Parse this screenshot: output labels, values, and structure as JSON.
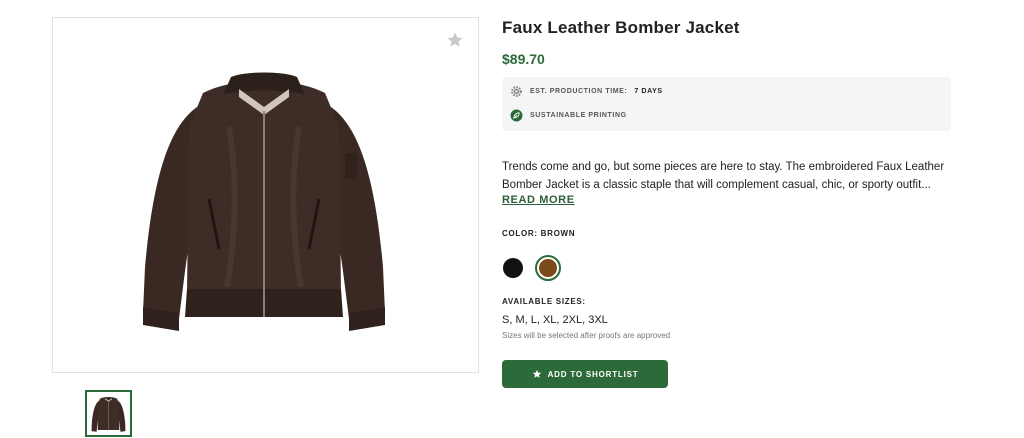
{
  "product": {
    "title": "Faux Leather Bomber Jacket",
    "price": "$89.70",
    "image_icon": "bomber-jacket-image",
    "favorite_icon": "star-icon"
  },
  "meta": {
    "production_label": "EST. PRODUCTION TIME:",
    "production_value": "7 DAYS",
    "production_icon": "gear-icon",
    "sustainable_label": "SUSTAINABLE PRINTING",
    "sustainable_icon": "leaf-icon"
  },
  "description": {
    "text": "Trends come and go, but some pieces are here to stay. The embroidered Faux Leather Bomber Jacket is a classic staple that will complement casual, chic, or sporty outfit...",
    "read_more": "READ MORE"
  },
  "color": {
    "label": "COLOR: BROWN",
    "options": [
      {
        "name": "black",
        "hex": "#111111",
        "selected": false
      },
      {
        "name": "brown",
        "hex": "#7a4a1b",
        "selected": true
      }
    ]
  },
  "sizes": {
    "label": "AVAILABLE SIZES:",
    "list": "S, M, L, XL, 2XL, 3XL",
    "note": "Sizes will be selected after proofs are approved"
  },
  "cta": {
    "label": "ADD TO SHORTLIST",
    "icon": "star-icon"
  },
  "colors": {
    "accent": "#2d6a3a",
    "jacket": "#3b2a24"
  }
}
